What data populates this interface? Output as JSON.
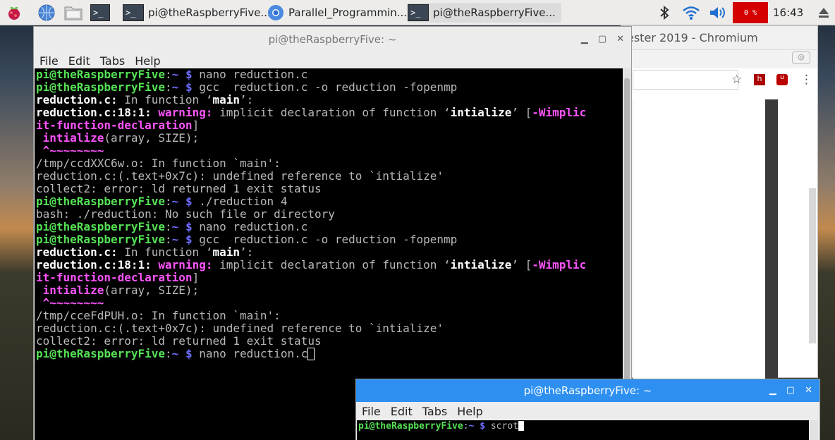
{
  "panel": {
    "tasks": [
      {
        "label": "pi@theRaspberryFive...",
        "icon": "terminal-icon"
      },
      {
        "label": "Parallel_Programmin...",
        "icon": "chromium-icon"
      },
      {
        "label": "pi@theRaspberryFive...",
        "icon": "terminal-icon"
      }
    ],
    "cpu": "0 %",
    "clock": "16:43"
  },
  "chromium": {
    "title": "ester 2019 - Chromium"
  },
  "terminal1": {
    "title": "pi@theRaspberryFive: ~",
    "menu": [
      "File",
      "Edit",
      "Tabs",
      "Help"
    ],
    "prompt_user": "pi@theRaspberryFive",
    "prompt_dir": "~ $",
    "lines": {
      "c1": "nano reduction.c",
      "c2": "gcc  reduction.c -o reduction -fopenmp",
      "f1": "reduction.c:",
      "f2": " In function ",
      "main": "main",
      "loc": "reduction.c:18:1:",
      "warn": "warning:",
      "impl": " implicit declaration of function ",
      "intl": "intialize",
      "flag1": "[",
      "flag2": "-Wimplic",
      "flag3": "it-function-declaration",
      "flag4": "]",
      "call_name": " intialize",
      "call_args": "(array, SIZE);",
      "caret": " ^~~~~~~~~",
      "tmp1": "/tmp/ccdXXC6w.o: In function `main':",
      "undef": "reduction.c:(.text+0x7c): undefined reference to `intialize'",
      "collect": "collect2: error: ld returned 1 exit status",
      "c3": "./reduction 4",
      "bash": "bash: ./reduction: No such file or directory",
      "tmp2": "/tmp/cceFdPUH.o: In function `main':",
      "c_last": "nano reduction.c"
    }
  },
  "terminal2": {
    "title": "pi@theRaspberryFive: ~",
    "menu": [
      "File",
      "Edit",
      "Tabs",
      "Help"
    ],
    "prompt_user": "pi@theRaspberryFive",
    "prompt_dir": "~ $",
    "command": "scrot"
  }
}
